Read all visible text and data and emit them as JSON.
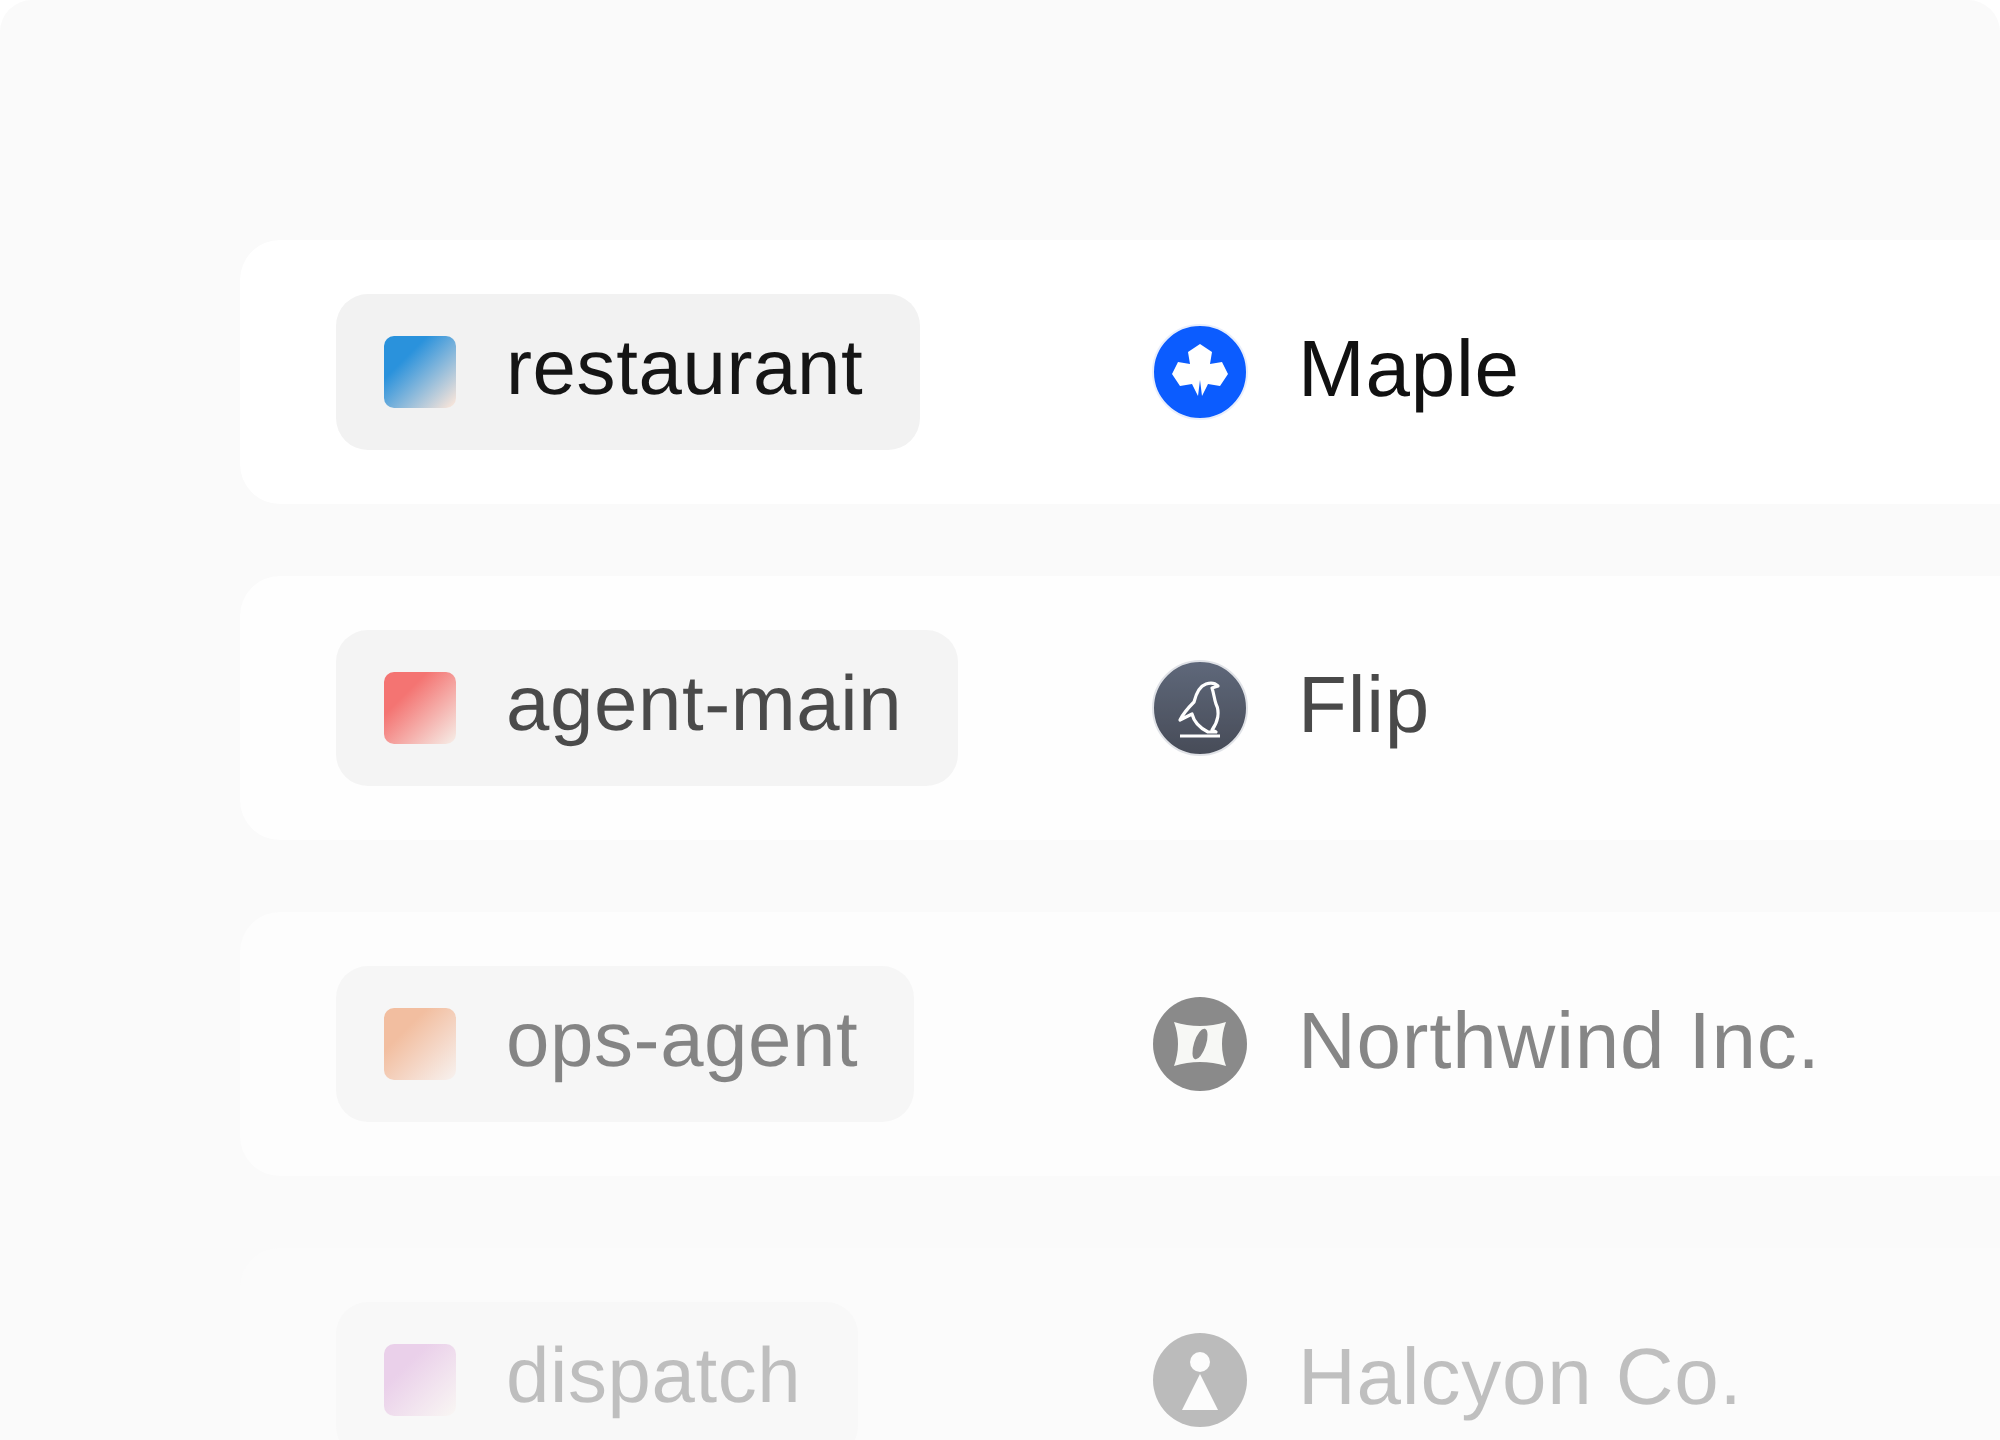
{
  "rows": [
    {
      "agent": {
        "name": "restaurant",
        "color": "#2a92dc"
      },
      "company": {
        "name": "Maple"
      }
    },
    {
      "agent": {
        "name": "agent-main",
        "color": "#f47472"
      },
      "company": {
        "name": "Flip"
      }
    },
    {
      "agent": {
        "name": "ops-agent",
        "color": "#f2bea0"
      },
      "company": {
        "name": "Northwind Inc."
      }
    },
    {
      "agent": {
        "name": "dispatch",
        "color": "#ead0ea"
      },
      "company": {
        "name": "Halcyon Co."
      }
    }
  ]
}
